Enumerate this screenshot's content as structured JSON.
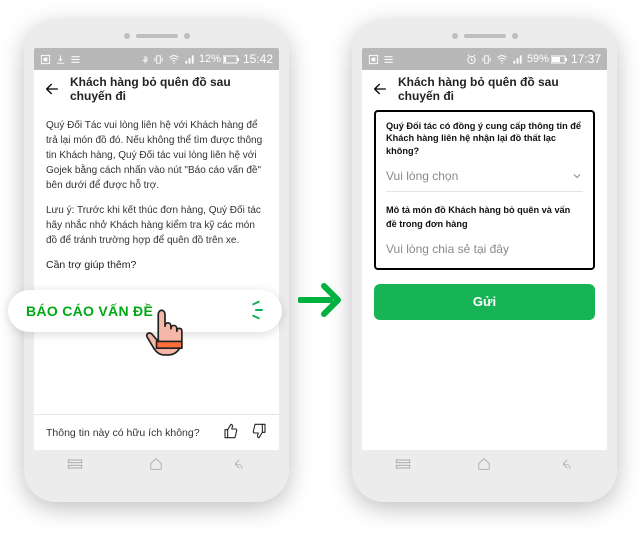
{
  "status_left": {
    "icons": [
      "screenshot-icon",
      "download-icon",
      "menu-icon"
    ]
  },
  "screens": {
    "left": {
      "status": {
        "batteryText": "12%",
        "time": "15:42"
      },
      "header": {
        "title": "Khách hàng bỏ quên đồ sau chuyến đi"
      },
      "body": {
        "p1": "Quý Đối Tác vui lòng liên hệ với Khách hàng để trả lại món đồ đó. Nếu không thể tìm được thông tin Khách hàng, Quý Đối tác vui lòng liên hệ với Gojek bằng cách nhấn vào nút \"Báo cáo vấn đề\" bên dưới để được hỗ trợ.",
        "p2": "Lưu ý: Trước khi kết thúc đơn hàng, Quý Đối tác hãy nhắc nhở Khách hàng kiểm tra kỹ các món đồ để tránh trường hợp để quên đồ trên xe.",
        "helpLabel": "Cần trợ giúp thêm?"
      },
      "pillLabel": "BÁO CÁO VẤN ĐỀ",
      "feedback": {
        "text": "Thông tin này có hữu ích không?"
      }
    },
    "right": {
      "status": {
        "batteryText": "59%",
        "time": "17:37"
      },
      "header": {
        "title": "Khách hàng bỏ quên đồ sau chuyến đi"
      },
      "form": {
        "q1": "Quý Đối tác có đồng ý cung cấp thông tin để Khách hàng liên hệ nhận lại đồ thất lạc không?",
        "selectPlaceholder": "Vui lòng chọn",
        "q2": "Mô tả món đồ Khách hàng bỏ quên và vấn đề trong đơn hàng",
        "taPlaceholder": "Vui lòng chia sẻ tại đây",
        "submit": "Gửi"
      }
    }
  }
}
